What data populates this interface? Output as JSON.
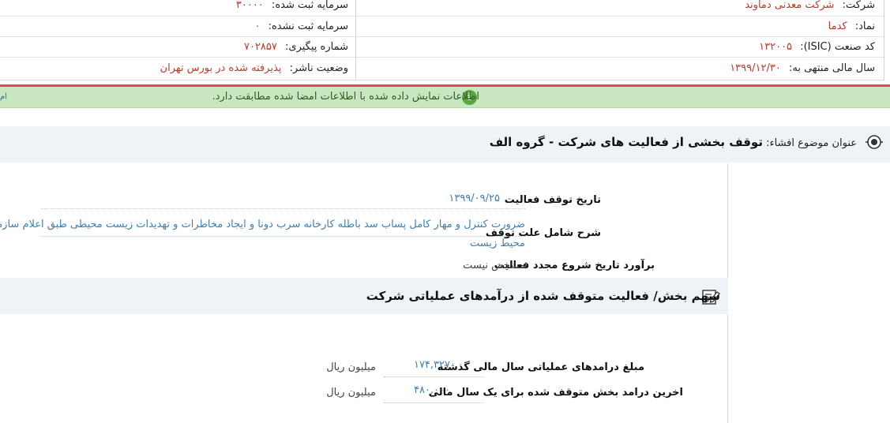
{
  "header": {
    "company_label": "شرکت:",
    "company_value": "شرکت معدنی دماوند",
    "registered_capital_label": "سرمایه ثبت شده:",
    "registered_capital_value": "۳۰۰۰۰",
    "symbol_label": "نماد:",
    "symbol_value": "کدما",
    "unregistered_capital_label": "سرمایه ثبت نشده:",
    "unregistered_capital_value": "۰",
    "isic_label": "کد صنعت (ISIC):",
    "isic_value": "۱۳۲۰۰۵",
    "tracking_label": "شماره پیگیری:",
    "tracking_value": "۷۰۲۸۵۷",
    "fiscal_year_label": "سال مالی منتهی به:",
    "fiscal_year_value": "۱۳۹۹/۱۲/۳۰",
    "publisher_status_label": "وضعیت ناشر:",
    "publisher_status_value": "پذیرفته شده در بورس تهران"
  },
  "notice": {
    "text": "اطلاعات نمایش داده شده با اطلاعات امضا شده مطابقت دارد.",
    "edge_glyph": "ام"
  },
  "disclosure": {
    "subject_label": "عنوان موضوع افشاء:",
    "subject_value": "توقف بخشی از فعالیت های شرکت - گروه الف"
  },
  "details": {
    "stop_date_label": "تاریخ توقف فعالیت",
    "stop_date_value": "۱۳۹۹/۰۹/۲۵",
    "reason_label": "شرح شامل علت توقف",
    "reason_value_line1": "ضرورت کنترل و مهار کامل پساب سد باطله کارخانه سرب دونا و ایجاد مخاطرات و تهدیدات زیست محیطی طبق اعلام سازمان",
    "reason_value_line2": "محیط زیست",
    "restart_label": "برآورد تاریخ شروع مجدد فعالیت",
    "restart_value": "مشخص نیست"
  },
  "revenue_section": {
    "title": "سهم بخش/ فعالیت متوقف شده از درآمدهای عملیاتی شرکت",
    "prev_year_label": "مبلغ درامدهای عملیاتی سال مالی گذشته",
    "prev_year_value": "۱۷۴,۳۲۷",
    "prev_year_unit": "میلیون ریال",
    "last_year_label": "اخرین درامد بخش متوقف شده برای یک سال مالی",
    "last_year_value": "۴۸۰,۰۰۰",
    "last_year_unit": "میلیون ریال"
  },
  "colors": {
    "accent_red": "#c0392b",
    "link_blue": "#3e7fb5",
    "notice_green_bg": "#c8e6c0",
    "divider_red": "#e24a4a"
  }
}
